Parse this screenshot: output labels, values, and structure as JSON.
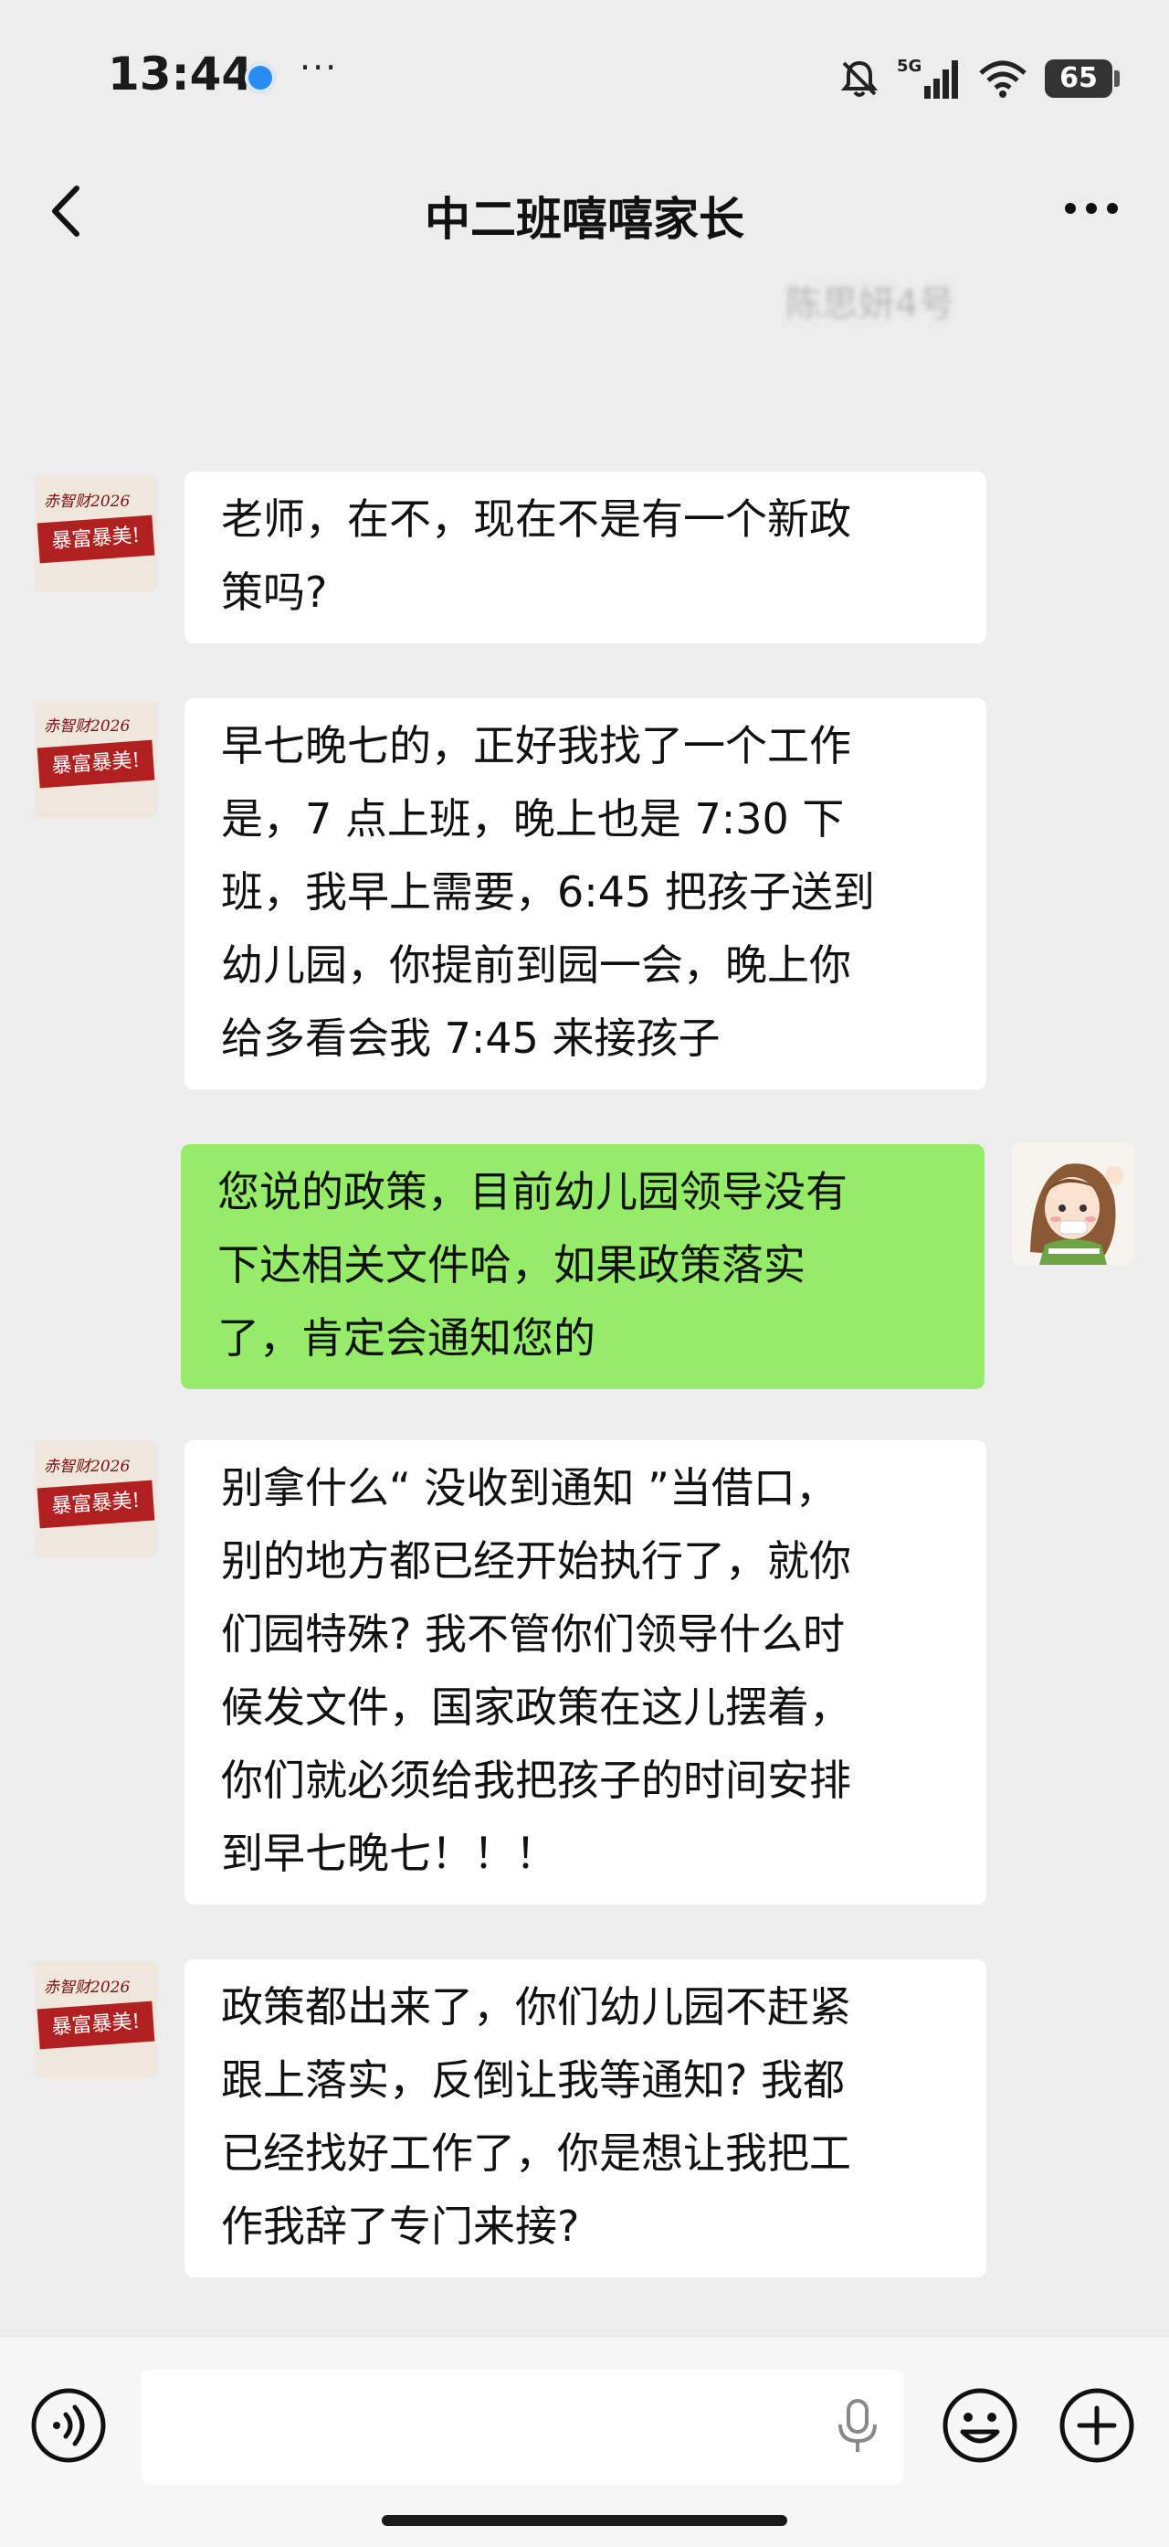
{
  "status_bar": {
    "time": "13:44",
    "more": "···",
    "network": "5G",
    "battery": "65"
  },
  "header": {
    "title": "中二班嘻嘻家长",
    "blurred_text": "陈思妍4号"
  },
  "contact_avatar": {
    "seal_top": "赤智财2026",
    "seal_banner": "暴富暴美!"
  },
  "messages": [
    {
      "side": "left",
      "lines": [
        "老师，在不，现在不是有一个新政",
        "策吗?"
      ]
    },
    {
      "side": "left",
      "lines": [
        "早七晚七的，正好我找了一个工作",
        "是，7 点上班，晚上也是 7:30 下",
        "班，我早上需要，6:45 把孩子送到",
        "幼儿园，你提前到园一会，晚上你",
        "给多看会我 7:45 来接孩子"
      ]
    },
    {
      "side": "right",
      "lines": [
        "您说的政策，目前幼儿园领导没有",
        "下达相关文件哈，如果政策落实",
        "了，肯定会通知您的"
      ]
    },
    {
      "side": "left",
      "lines": [
        "别拿什么“ 没收到通知 ”当借口，",
        "别的地方都已经开始执行了，就你",
        "们园特殊? 我不管你们领导什么时",
        "候发文件，国家政策在这儿摆着，",
        "你们就必须给我把孩子的时间安排",
        "到早七晚七！！！"
      ]
    },
    {
      "side": "left",
      "lines": [
        "政策都出来了，你们幼儿园不赶紧",
        "跟上落实，反倒让我等通知? 我都",
        "已经找好工作了，你是想让我把工",
        "作我辞了专门来接?"
      ]
    }
  ],
  "colors": {
    "background": "#ededed",
    "bubble_received": "#ffffff",
    "bubble_sent": "#95ec69"
  },
  "icons": {
    "back": "chevron-left-icon",
    "more": "more-dots-icon",
    "voice": "voice-icon",
    "mic": "mic-icon",
    "emoji": "emoji-icon",
    "plus": "plus-icon"
  }
}
